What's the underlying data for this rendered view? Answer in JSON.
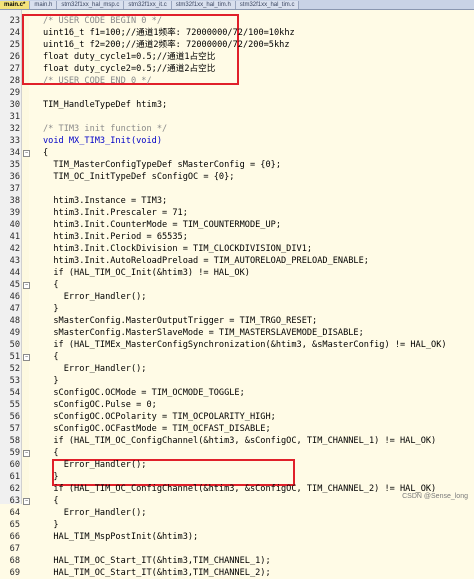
{
  "tabs": [
    {
      "label": "main.c*",
      "active": true
    },
    {
      "label": "main.h",
      "active": false
    },
    {
      "label": "stm32f1xx_hal_msp.c",
      "active": false
    },
    {
      "label": "stm32f1xx_it.c",
      "active": false
    },
    {
      "label": "stm32f1xx_hal_tim.h",
      "active": false
    },
    {
      "label": "stm32f1xx_hal_tim.c",
      "active": false
    }
  ],
  "lines": [
    {
      "n": "23",
      "t": "/* USER CODE BEGIN 0 */",
      "c": "comment"
    },
    {
      "n": "24",
      "t": "uint16_t f1=100;//通道1频率: 72000000/72/100=10khz",
      "c": ""
    },
    {
      "n": "25",
      "t": "uint16_t f2=200;//通道2频率: 72000000/72/200=5khz",
      "c": ""
    },
    {
      "n": "26",
      "t": "float duty_cycle1=0.5;//通道1占空比",
      "c": ""
    },
    {
      "n": "27",
      "t": "float duty_cycle2=0.5;//通道2占空比",
      "c": ""
    },
    {
      "n": "28",
      "t": "/* USER CODE END 0 */",
      "c": "comment"
    },
    {
      "n": "29",
      "t": "",
      "c": ""
    },
    {
      "n": "30",
      "t": "TIM_HandleTypeDef htim3;",
      "c": ""
    },
    {
      "n": "31",
      "t": "",
      "c": ""
    },
    {
      "n": "32",
      "t": "/* TIM3 init function */",
      "c": "comment"
    },
    {
      "n": "33",
      "t": "void MX_TIM3_Init(void)",
      "c": "kw"
    },
    {
      "n": "34",
      "t": "{",
      "c": ""
    },
    {
      "n": "35",
      "t": "  TIM_MasterConfigTypeDef sMasterConfig = {0};",
      "c": ""
    },
    {
      "n": "36",
      "t": "  TIM_OC_InitTypeDef sConfigOC = {0};",
      "c": ""
    },
    {
      "n": "37",
      "t": "",
      "c": ""
    },
    {
      "n": "38",
      "t": "  htim3.Instance = TIM3;",
      "c": ""
    },
    {
      "n": "39",
      "t": "  htim3.Init.Prescaler = 71;",
      "c": ""
    },
    {
      "n": "40",
      "t": "  htim3.Init.CounterMode = TIM_COUNTERMODE_UP;",
      "c": ""
    },
    {
      "n": "41",
      "t": "  htim3.Init.Period = 65535;",
      "c": ""
    },
    {
      "n": "42",
      "t": "  htim3.Init.ClockDivision = TIM_CLOCKDIVISION_DIV1;",
      "c": ""
    },
    {
      "n": "43",
      "t": "  htim3.Init.AutoReloadPreload = TIM_AUTORELOAD_PRELOAD_ENABLE;",
      "c": ""
    },
    {
      "n": "44",
      "t": "  if (HAL_TIM_OC_Init(&htim3) != HAL_OK)",
      "c": ""
    },
    {
      "n": "45",
      "t": "  {",
      "c": ""
    },
    {
      "n": "46",
      "t": "    Error_Handler();",
      "c": ""
    },
    {
      "n": "47",
      "t": "  }",
      "c": ""
    },
    {
      "n": "48",
      "t": "  sMasterConfig.MasterOutputTrigger = TIM_TRGO_RESET;",
      "c": ""
    },
    {
      "n": "49",
      "t": "  sMasterConfig.MasterSlaveMode = TIM_MASTERSLAVEMODE_DISABLE;",
      "c": ""
    },
    {
      "n": "50",
      "t": "  if (HAL_TIMEx_MasterConfigSynchronization(&htim3, &sMasterConfig) != HAL_OK)",
      "c": ""
    },
    {
      "n": "51",
      "t": "  {",
      "c": ""
    },
    {
      "n": "52",
      "t": "    Error_Handler();",
      "c": ""
    },
    {
      "n": "53",
      "t": "  }",
      "c": ""
    },
    {
      "n": "54",
      "t": "  sConfigOC.OCMode = TIM_OCMODE_TOGGLE;",
      "c": ""
    },
    {
      "n": "55",
      "t": "  sConfigOC.Pulse = 0;",
      "c": ""
    },
    {
      "n": "56",
      "t": "  sConfigOC.OCPolarity = TIM_OCPOLARITY_HIGH;",
      "c": ""
    },
    {
      "n": "57",
      "t": "  sConfigOC.OCFastMode = TIM_OCFAST_DISABLE;",
      "c": ""
    },
    {
      "n": "58",
      "t": "  if (HAL_TIM_OC_ConfigChannel(&htim3, &sConfigOC, TIM_CHANNEL_1) != HAL_OK)",
      "c": ""
    },
    {
      "n": "59",
      "t": "  {",
      "c": ""
    },
    {
      "n": "60",
      "t": "    Error_Handler();",
      "c": ""
    },
    {
      "n": "61",
      "t": "  }",
      "c": ""
    },
    {
      "n": "62",
      "t": "  if (HAL_TIM_OC_ConfigChannel(&htim3, &sConfigOC, TIM_CHANNEL_2) != HAL_OK)",
      "c": ""
    },
    {
      "n": "63",
      "t": "  {",
      "c": ""
    },
    {
      "n": "64",
      "t": "    Error_Handler();",
      "c": ""
    },
    {
      "n": "65",
      "t": "  }",
      "c": ""
    },
    {
      "n": "66",
      "t": "  HAL_TIM_MspPostInit(&htim3);",
      "c": ""
    },
    {
      "n": "67",
      "t": "",
      "c": ""
    },
    {
      "n": "68",
      "t": "  HAL_TIM_OC_Start_IT(&htim3,TIM_CHANNEL_1);",
      "c": ""
    },
    {
      "n": "69",
      "t": "  HAL_TIM_OC_Start_IT(&htim3,TIM_CHANNEL_2);",
      "c": ""
    }
  ],
  "fold_markers": [
    "34",
    "45",
    "51",
    "59",
    "63"
  ],
  "watermark": "CSDN @Sense_long",
  "highlight_color": "#e0202a"
}
